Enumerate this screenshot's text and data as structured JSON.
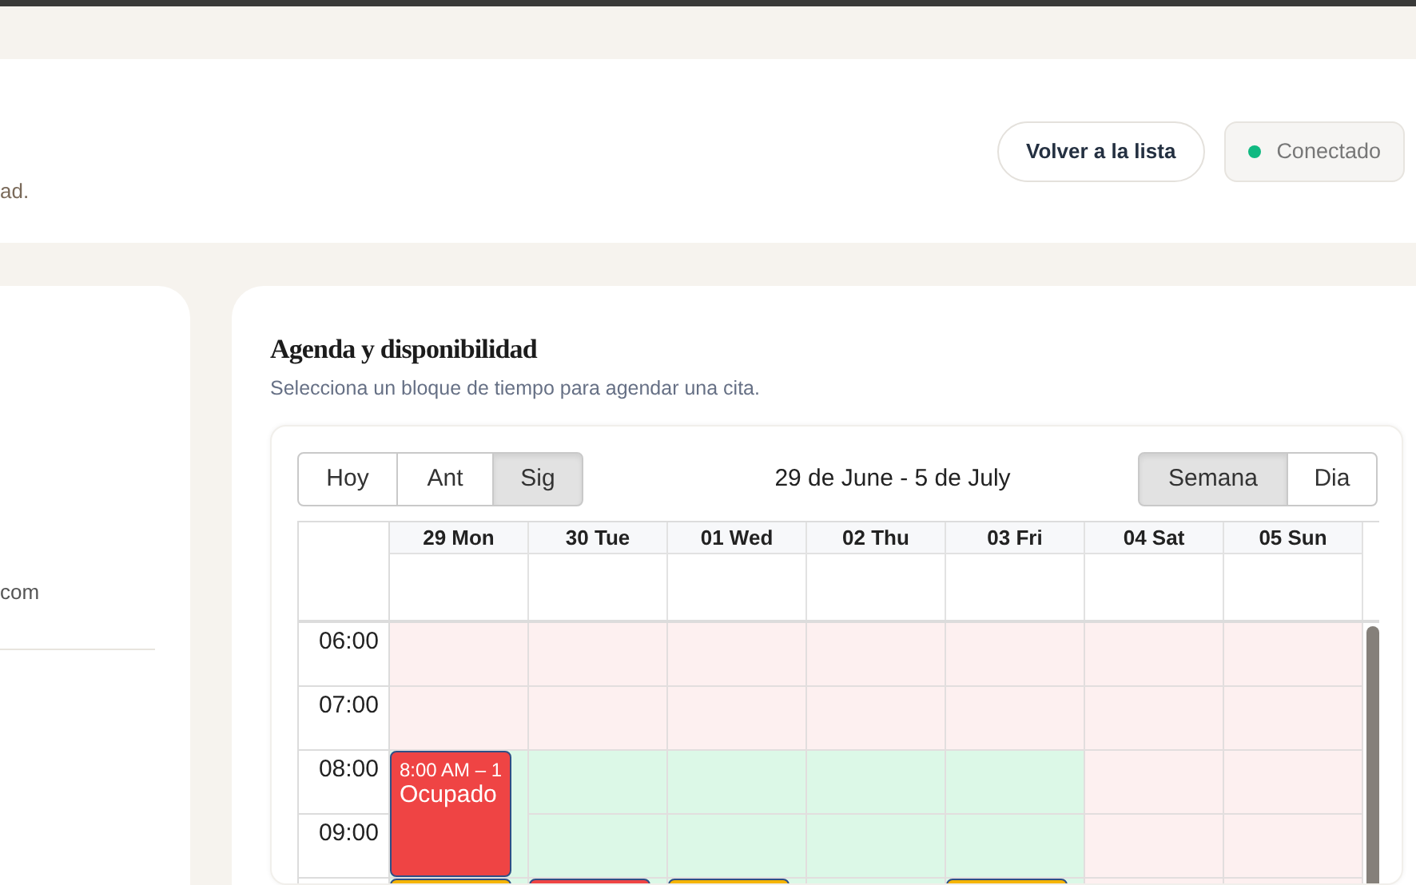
{
  "header": {
    "subtitle_fragment": "ad.",
    "buttons": [
      {
        "label": "Volver a la lista"
      }
    ],
    "status": {
      "label": "Conectado",
      "color": "#10b981"
    }
  },
  "sidebar": {
    "text_fragment": "com"
  },
  "agenda": {
    "title": "Agenda y disponibilidad",
    "subtitle": "Selecciona un bloque de tiempo para agendar una cita.",
    "nav_buttons": [
      {
        "label": "Hoy",
        "selected": false
      },
      {
        "label": "Ant",
        "selected": false
      },
      {
        "label": "Sig",
        "selected": true
      }
    ],
    "range": "29 de June - 5 de July",
    "view_tabs": [
      {
        "label": "Semana",
        "selected": true
      },
      {
        "label": "Dia",
        "selected": false
      }
    ],
    "days": [
      "29 Mon",
      "30 Tue",
      "01 Wed",
      "02 Thu",
      "03 Fri",
      "04 Sat",
      "05 Sun"
    ],
    "rows": [
      {
        "time": "06:00",
        "cells": [
          {
            "kind": "unavailable"
          },
          {
            "kind": "unavailable"
          },
          {
            "kind": "unavailable"
          },
          {
            "kind": "unavailable"
          },
          {
            "kind": "unavailable"
          },
          {
            "kind": "unavailable"
          },
          {
            "kind": "unavailable"
          }
        ]
      },
      {
        "time": "07:00",
        "cells": [
          {
            "kind": "unavailable"
          },
          {
            "kind": "unavailable"
          },
          {
            "kind": "unavailable"
          },
          {
            "kind": "unavailable"
          },
          {
            "kind": "unavailable"
          },
          {
            "kind": "unavailable"
          },
          {
            "kind": "unavailable"
          }
        ]
      },
      {
        "time": "08:00",
        "cells": [
          {
            "kind": "available",
            "event": {
              "time": "8:00 AM – 1",
              "title": "Ocupado",
              "color": "#ef4444"
            }
          },
          {
            "kind": "available"
          },
          {
            "kind": "available"
          },
          {
            "kind": "available"
          },
          {
            "kind": "available"
          },
          {
            "kind": "unavailable"
          },
          {
            "kind": "unavailable"
          }
        ]
      },
      {
        "time": "09:00",
        "cells": [
          null,
          {
            "kind": "available"
          },
          {
            "kind": "available"
          },
          {
            "kind": "available"
          },
          {
            "kind": "available"
          },
          {
            "kind": "unavailable"
          },
          {
            "kind": "unavailable"
          }
        ]
      },
      {
        "cells": [
          {
            "kind": "available",
            "event": {
              "color": "#f5b400"
            }
          },
          {
            "kind": "available",
            "event": {
              "color": "#ef4444"
            }
          },
          {
            "kind": "available",
            "event": {
              "color": "#f5b400"
            }
          },
          {
            "kind": "available"
          },
          {
            "kind": "available",
            "event": {
              "color": "#f5b400"
            }
          },
          {
            "kind": "unavailable"
          },
          {
            "kind": "unavailable"
          }
        ]
      }
    ]
  }
}
